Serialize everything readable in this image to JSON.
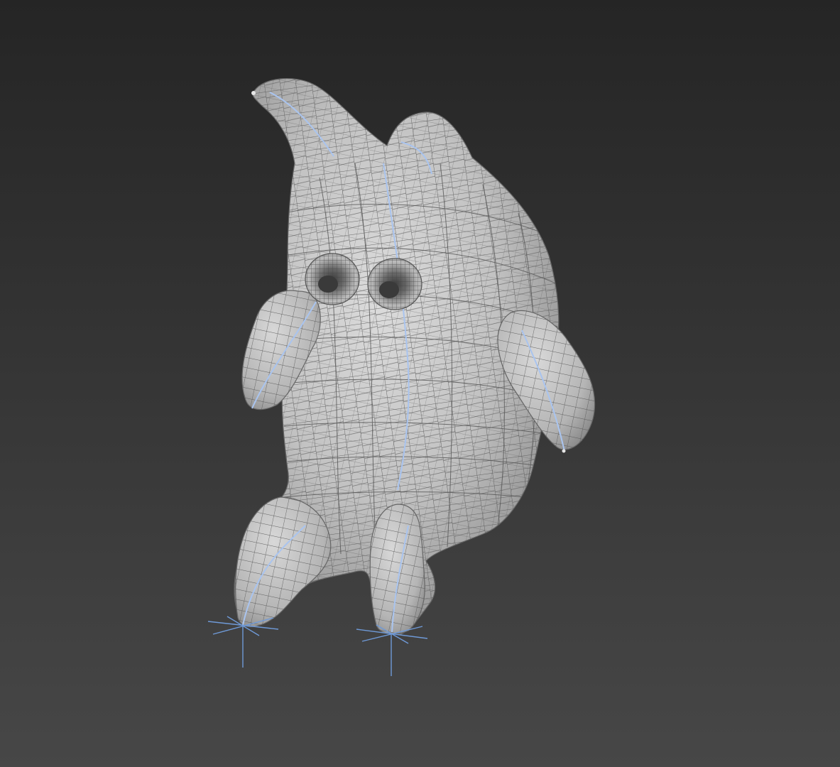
{
  "viewport": {
    "background_top": "#252525",
    "background_bottom": "#474747"
  },
  "model": {
    "name_icon": "character-mesh",
    "shading": "wireframe-over-shaded",
    "mesh_fill": "#c4c4c4",
    "mesh_shadow": "#8c8c8c",
    "wire_color": "#5a5a5a",
    "bone_color": "#a9c4ef"
  },
  "gizmos": {
    "icon": "bone-end-effector-icon",
    "color": "#6f9ad8",
    "count": 2
  }
}
